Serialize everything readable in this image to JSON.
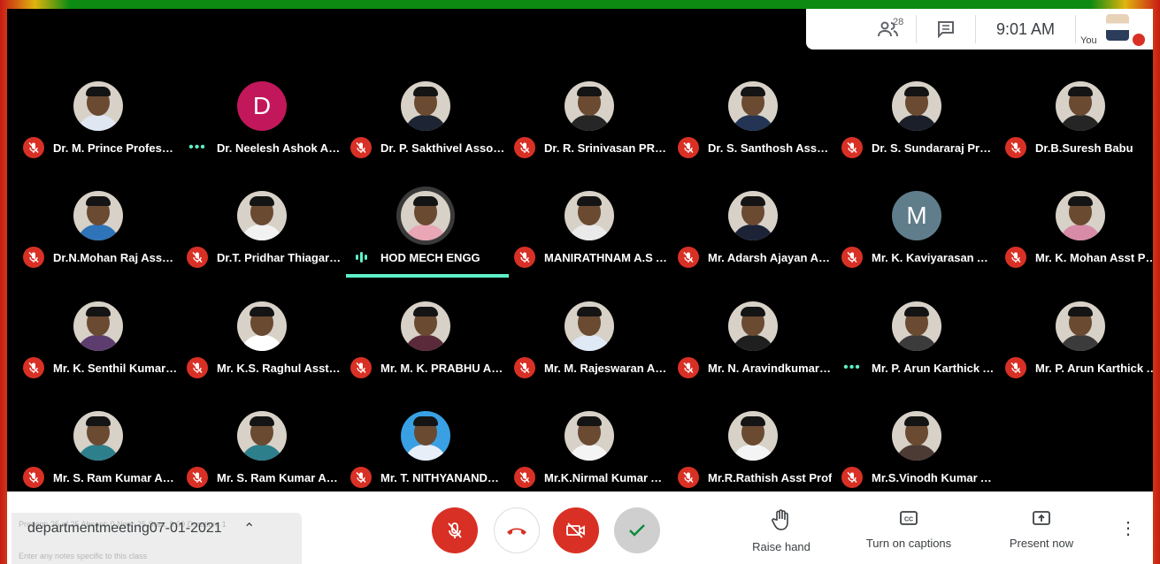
{
  "topbar": {
    "people_count": "28",
    "time": "9:01 AM",
    "you_label": "You"
  },
  "participants": [
    {
      "name": "Dr. M. Prince Professor",
      "mic": "muted",
      "shirt": "#dfe7f3"
    },
    {
      "name": "Dr. Neelesh Ashok Assoc",
      "mic": "dots",
      "letter": "D",
      "avatar_color": "#c2185b"
    },
    {
      "name": "Dr. P. Sakthivel Asso Prof",
      "mic": "muted",
      "shirt": "#1d2433"
    },
    {
      "name": "Dr. R. Srinivasan PROF",
      "mic": "muted",
      "shirt": "#262626"
    },
    {
      "name": "Dr. S. Santhosh Asso Prof",
      "mic": "muted",
      "shirt": "#233455"
    },
    {
      "name": "Dr. S. Sundararaj Professor",
      "mic": "muted",
      "shirt": "#1b1f2a"
    },
    {
      "name": "Dr.B.Suresh Babu",
      "mic": "muted",
      "shirt": "#252525"
    },
    {
      "name": "Dr.N.Mohan Raj Associate",
      "mic": "muted",
      "shirt": "#2f73b8"
    },
    {
      "name": "Dr.T. Pridhar Thiagarajan",
      "mic": "muted",
      "shirt": "#f2f2f2"
    },
    {
      "name": "HOD MECH ENGG",
      "mic": "speaking",
      "shirt": "#e9a6b4",
      "active": true
    },
    {
      "name": "MANIRATHNAM A.S Asst",
      "mic": "muted",
      "shirt": "#eaeaea"
    },
    {
      "name": "Mr. Adarsh Ajayan Asst Prof",
      "mic": "muted",
      "shirt": "#1c2336"
    },
    {
      "name": "Mr. K. Kaviyarasan Asst",
      "mic": "muted",
      "letter": "M",
      "avatar_color": "#607d8b"
    },
    {
      "name": "Mr. K. Mohan Asst Prof",
      "mic": "muted",
      "shirt": "#d78ba6"
    },
    {
      "name": "Mr. K. Senthil Kumar Asst",
      "mic": "muted",
      "shirt": "#5c3d6e"
    },
    {
      "name": "Mr. K.S. Raghul Asst Prof",
      "mic": "muted",
      "shirt": "#ffffff"
    },
    {
      "name": "Mr. M. K. PRABHU Asst",
      "mic": "muted",
      "shirt": "#5a2a3a"
    },
    {
      "name": "Mr. M. Rajeswaran Asst",
      "mic": "muted",
      "shirt": "#dfeaf6"
    },
    {
      "name": "Mr. N. Aravindkumar Asst",
      "mic": "muted",
      "shirt": "#1f1f1f"
    },
    {
      "name": "Mr. P. Arun Karthick Asst",
      "mic": "dots",
      "shirt": "#3b3b3b"
    },
    {
      "name": "Mr. P. Arun Karthick Asst",
      "mic": "muted",
      "shirt": "#3b3b3b"
    },
    {
      "name": "Mr. S. Ram Kumar Asst",
      "mic": "muted",
      "shirt": "#2e7f8c"
    },
    {
      "name": "Mr. S. Ram Kumar Asst",
      "mic": "muted",
      "shirt": "#2e7f8c"
    },
    {
      "name": "Mr. T. NITHYANANDHAN",
      "mic": "muted",
      "shirt": "#e8eef7",
      "bg": "#39a0e3"
    },
    {
      "name": "Mr.K.Nirmal Kumar Asst",
      "mic": "muted",
      "shirt": "#f4f4f4"
    },
    {
      "name": "Mr.R.Rathish Asst Prof",
      "mic": "muted",
      "shirt": "#f4f4f4"
    },
    {
      "name": "Mr.S.Vinodh Kumar Asst",
      "mic": "muted",
      "shirt": "#4b3b34"
    }
  ],
  "bottombar": {
    "meeting_title": "departmentmeeting07-01-2021",
    "ghost_line1": "Present: 25 of 25   Absent: 0   New: 25   Start: 9:00   Duration: 1",
    "ghost_line2": "Enter any notes specific to this class",
    "raise_hand": "Raise hand",
    "captions": "Turn on captions",
    "present_now": "Present now"
  },
  "colors": {
    "muted_red": "#d93025",
    "speaking_teal": "#5ef0c8",
    "meet_bg": "#000000"
  }
}
